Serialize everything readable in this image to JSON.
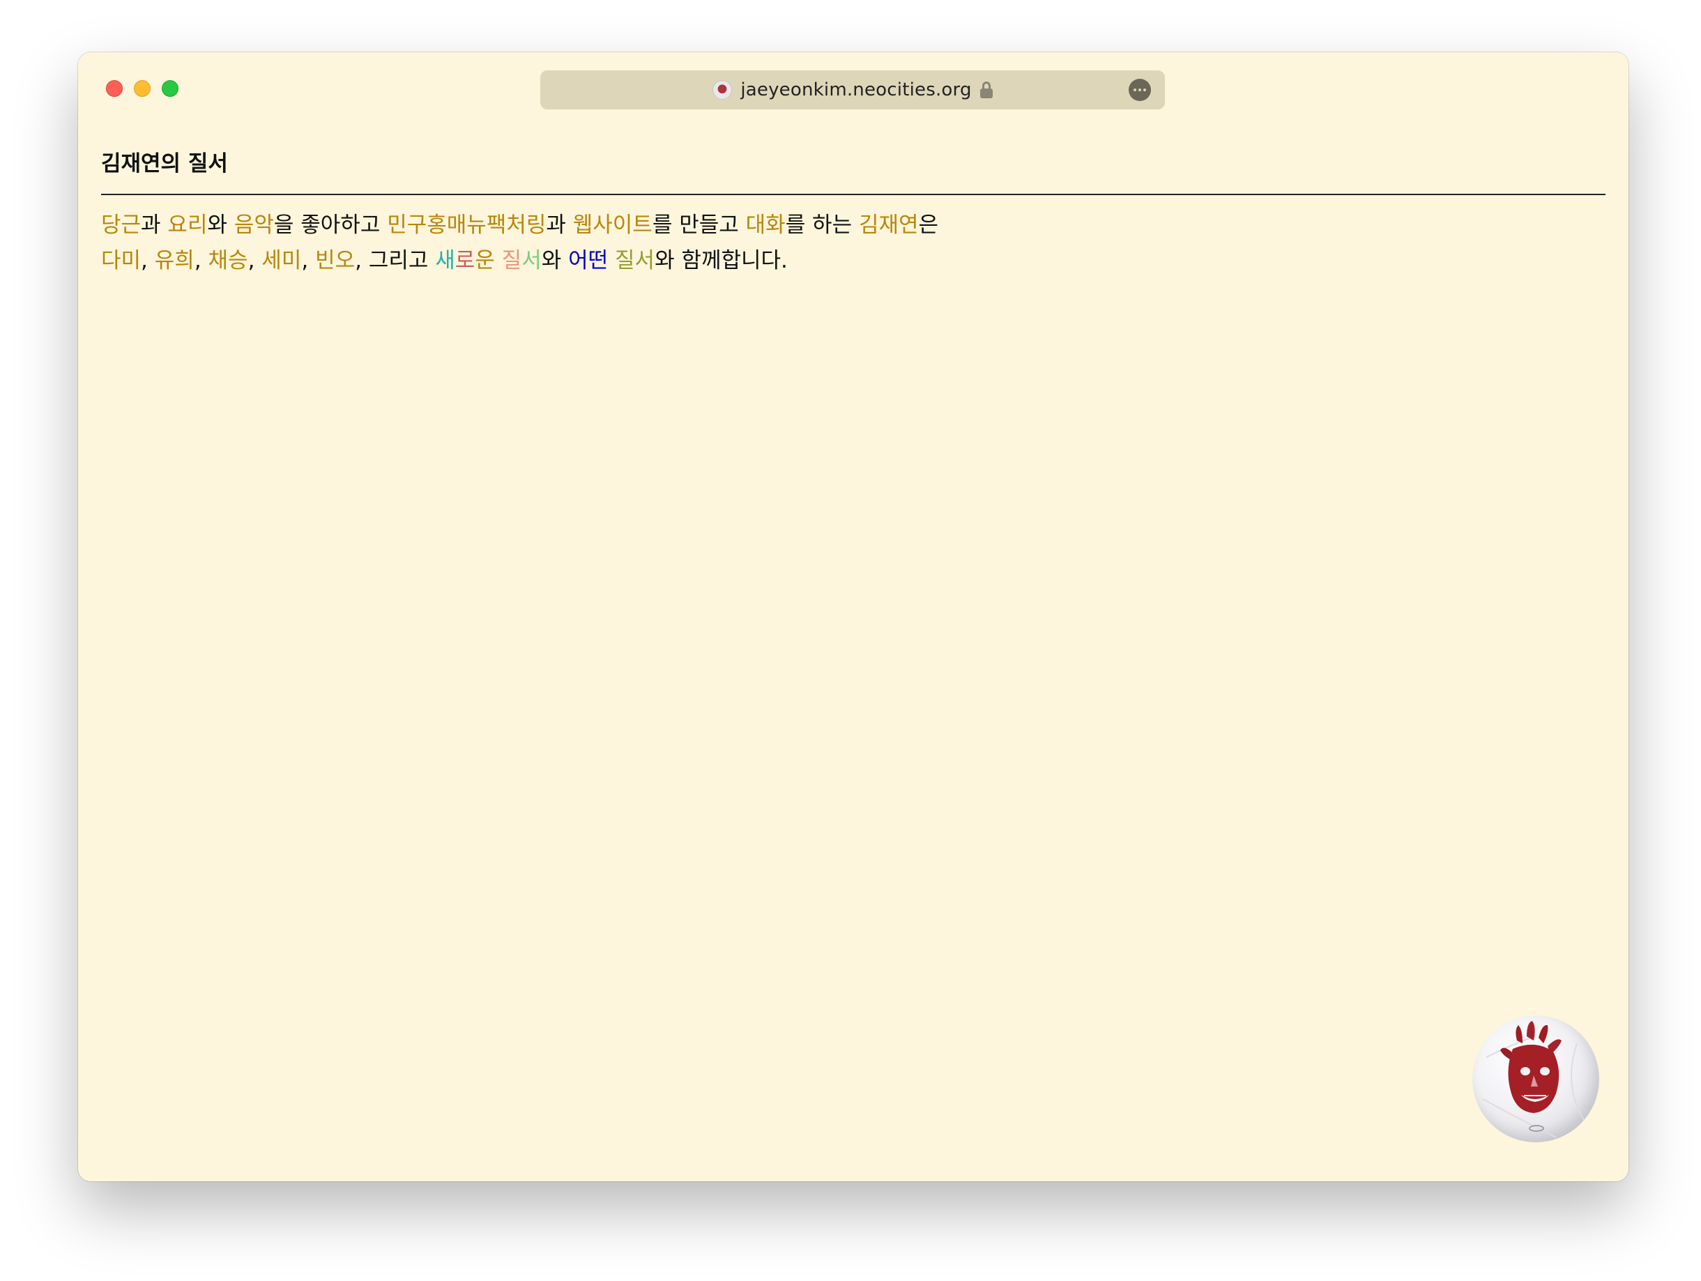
{
  "browser": {
    "url": "jaeyeonkim.neocities.org"
  },
  "page": {
    "title": "김재연의 질서",
    "line1": [
      {
        "text": "당근",
        "color": "#b8860b"
      },
      {
        "text": "과 ",
        "color": ""
      },
      {
        "text": "요리",
        "color": "#b8860b"
      },
      {
        "text": "와 ",
        "color": ""
      },
      {
        "text": "음악",
        "color": "#b8860b"
      },
      {
        "text": "을 좋아하고 ",
        "color": ""
      },
      {
        "text": "민구홍매뉴팩처링",
        "color": "#b8860b"
      },
      {
        "text": "과 ",
        "color": ""
      },
      {
        "text": "웹사이트",
        "color": "#b8860b"
      },
      {
        "text": "를 만들고 ",
        "color": ""
      },
      {
        "text": "대화",
        "color": "#b8860b"
      },
      {
        "text": "를 하는 ",
        "color": ""
      },
      {
        "text": "김재연",
        "color": "#b8860b"
      },
      {
        "text": "은",
        "color": ""
      }
    ],
    "line2": [
      {
        "text": "다미",
        "color": "#b8860b"
      },
      {
        "text": ", ",
        "color": ""
      },
      {
        "text": "유희",
        "color": "#b8860b"
      },
      {
        "text": ", ",
        "color": ""
      },
      {
        "text": "채승",
        "color": "#b8860b"
      },
      {
        "text": ", ",
        "color": ""
      },
      {
        "text": "세미",
        "color": "#b8860b"
      },
      {
        "text": ", ",
        "color": ""
      },
      {
        "text": "빈오",
        "color": "#b8860b"
      },
      {
        "text": ", 그리고 ",
        "color": ""
      },
      {
        "text": "새",
        "color": "#20b2aa"
      },
      {
        "text": "로",
        "color": "#cd5c5c"
      },
      {
        "text": "운 ",
        "color": "#b8860b"
      },
      {
        "text": "질",
        "color": "#e9967a"
      },
      {
        "text": "서",
        "color": "#7ccd7c"
      },
      {
        "text": "와 ",
        "color": ""
      },
      {
        "text": "어떤",
        "color": "#0000cd"
      },
      {
        "text": " ",
        "color": ""
      },
      {
        "text": "질서",
        "color": "#9a9a32"
      },
      {
        "text": "와 함께합니다.",
        "color": ""
      }
    ]
  },
  "icons": {
    "favicon": "volleyball-face-favicon",
    "lock": "lock-icon",
    "more": "more-options-icon",
    "floating": "volleyball-wilson-image"
  }
}
